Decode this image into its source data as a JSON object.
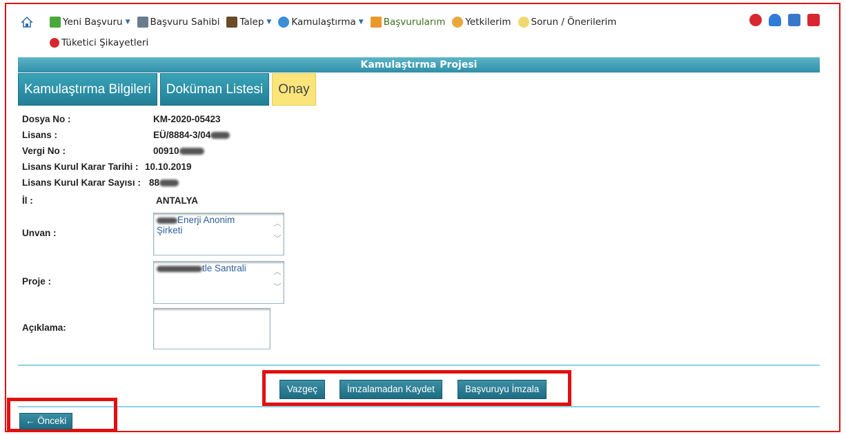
{
  "nav": {
    "items": [
      {
        "label": "Yeni Başvuru",
        "has_caret": true
      },
      {
        "label": "Başvuru Sahibi",
        "has_caret": false
      },
      {
        "label": "Talep",
        "has_caret": true
      },
      {
        "label": "Kamulaştırma",
        "has_caret": true
      },
      {
        "label": "Başvurularım",
        "has_caret": false
      },
      {
        "label": "Yetkilerim",
        "has_caret": false
      },
      {
        "label": "Sorun / Önerilerim",
        "has_caret": false
      }
    ],
    "second_row": "Tüketici Şikayetleri"
  },
  "page": {
    "title": "Kamulaştırma Projesi",
    "tabs": [
      "Kamulaştırma Bilgileri",
      "Doküman Listesi",
      "Onay"
    ]
  },
  "form": {
    "dosya_no_label": "Dosya No :",
    "dosya_no": "KM-2020-05423",
    "lisans_label": "Lisans :",
    "lisans": "EÜ/8884-3/04",
    "vergi_label": "Vergi No :",
    "vergi": "00910",
    "karar_tarihi_label": "Lisans Kurul Karar Tarihi :",
    "karar_tarihi": "10.10.2019",
    "karar_sayisi_label": "Lisans Kurul Karar Sayısı :",
    "karar_sayisi": "88",
    "il_label": "İl :",
    "il": "ANTALYA",
    "unvan_label": "Unvan :",
    "unvan_line1": "Enerji Anonim",
    "unvan_line2": "Şirketi",
    "proje_label": "Proje :",
    "proje": "tle Santrali",
    "aciklama_label": "Açıklama:"
  },
  "buttons": {
    "vazgec": "Vazgeç",
    "imzalamadan": "İmzalamadan Kaydet",
    "imzala": "Başvuruyu İmzala",
    "onceki": "← Önceki"
  },
  "colors": {
    "accent": "#2f8fa8",
    "highlight_border": "#e01010",
    "active_tab": "#fbe57a"
  }
}
